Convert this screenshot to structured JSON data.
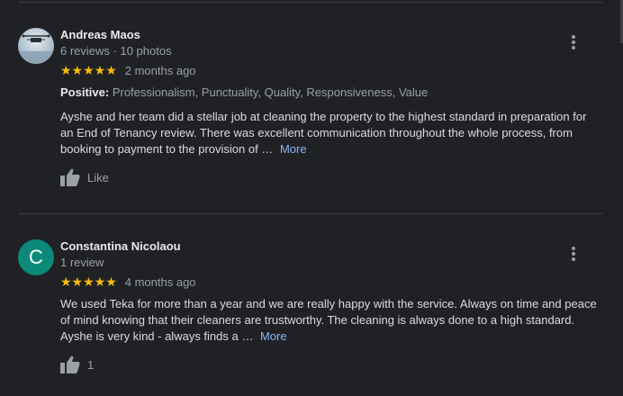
{
  "reviews": [
    {
      "name": "Andreas Maos",
      "meta": "6 reviews · 10 photos",
      "stars": "★★★★★",
      "rating": 5,
      "ago": "2 months ago",
      "attrs_label": "Positive:",
      "attrs_values": "Professionalism, Punctuality, Quality, Responsiveness, Value",
      "text": "Ayshe and her team did a stellar job at cleaning the property to the highest standard in preparation for an End of Tenancy review. There was excellent communication throughout the whole process, from booking to payment to the provision of …",
      "more": "More",
      "like_label": "Like"
    },
    {
      "avatar_letter": "C",
      "name": "Constantina Nicolaou",
      "meta": "1 review",
      "stars": "★★★★★",
      "rating": 5,
      "ago": "4 months ago",
      "text": "We used Teka for more than a year and we are really happy with the service. Always on time and peace of mind knowing that their cleaners are trustworthy. The cleaning is always done to a high standard. Ayshe is very kind - always finds a …",
      "more": "More",
      "like_label": "1"
    }
  ],
  "colors": {
    "background": "#202124",
    "star": "#fbbc04",
    "link": "#8ab4f8",
    "avatar_c": "#0b8a7a"
  },
  "icons": [
    "more-vert-icon",
    "thumbs-up-icon"
  ]
}
